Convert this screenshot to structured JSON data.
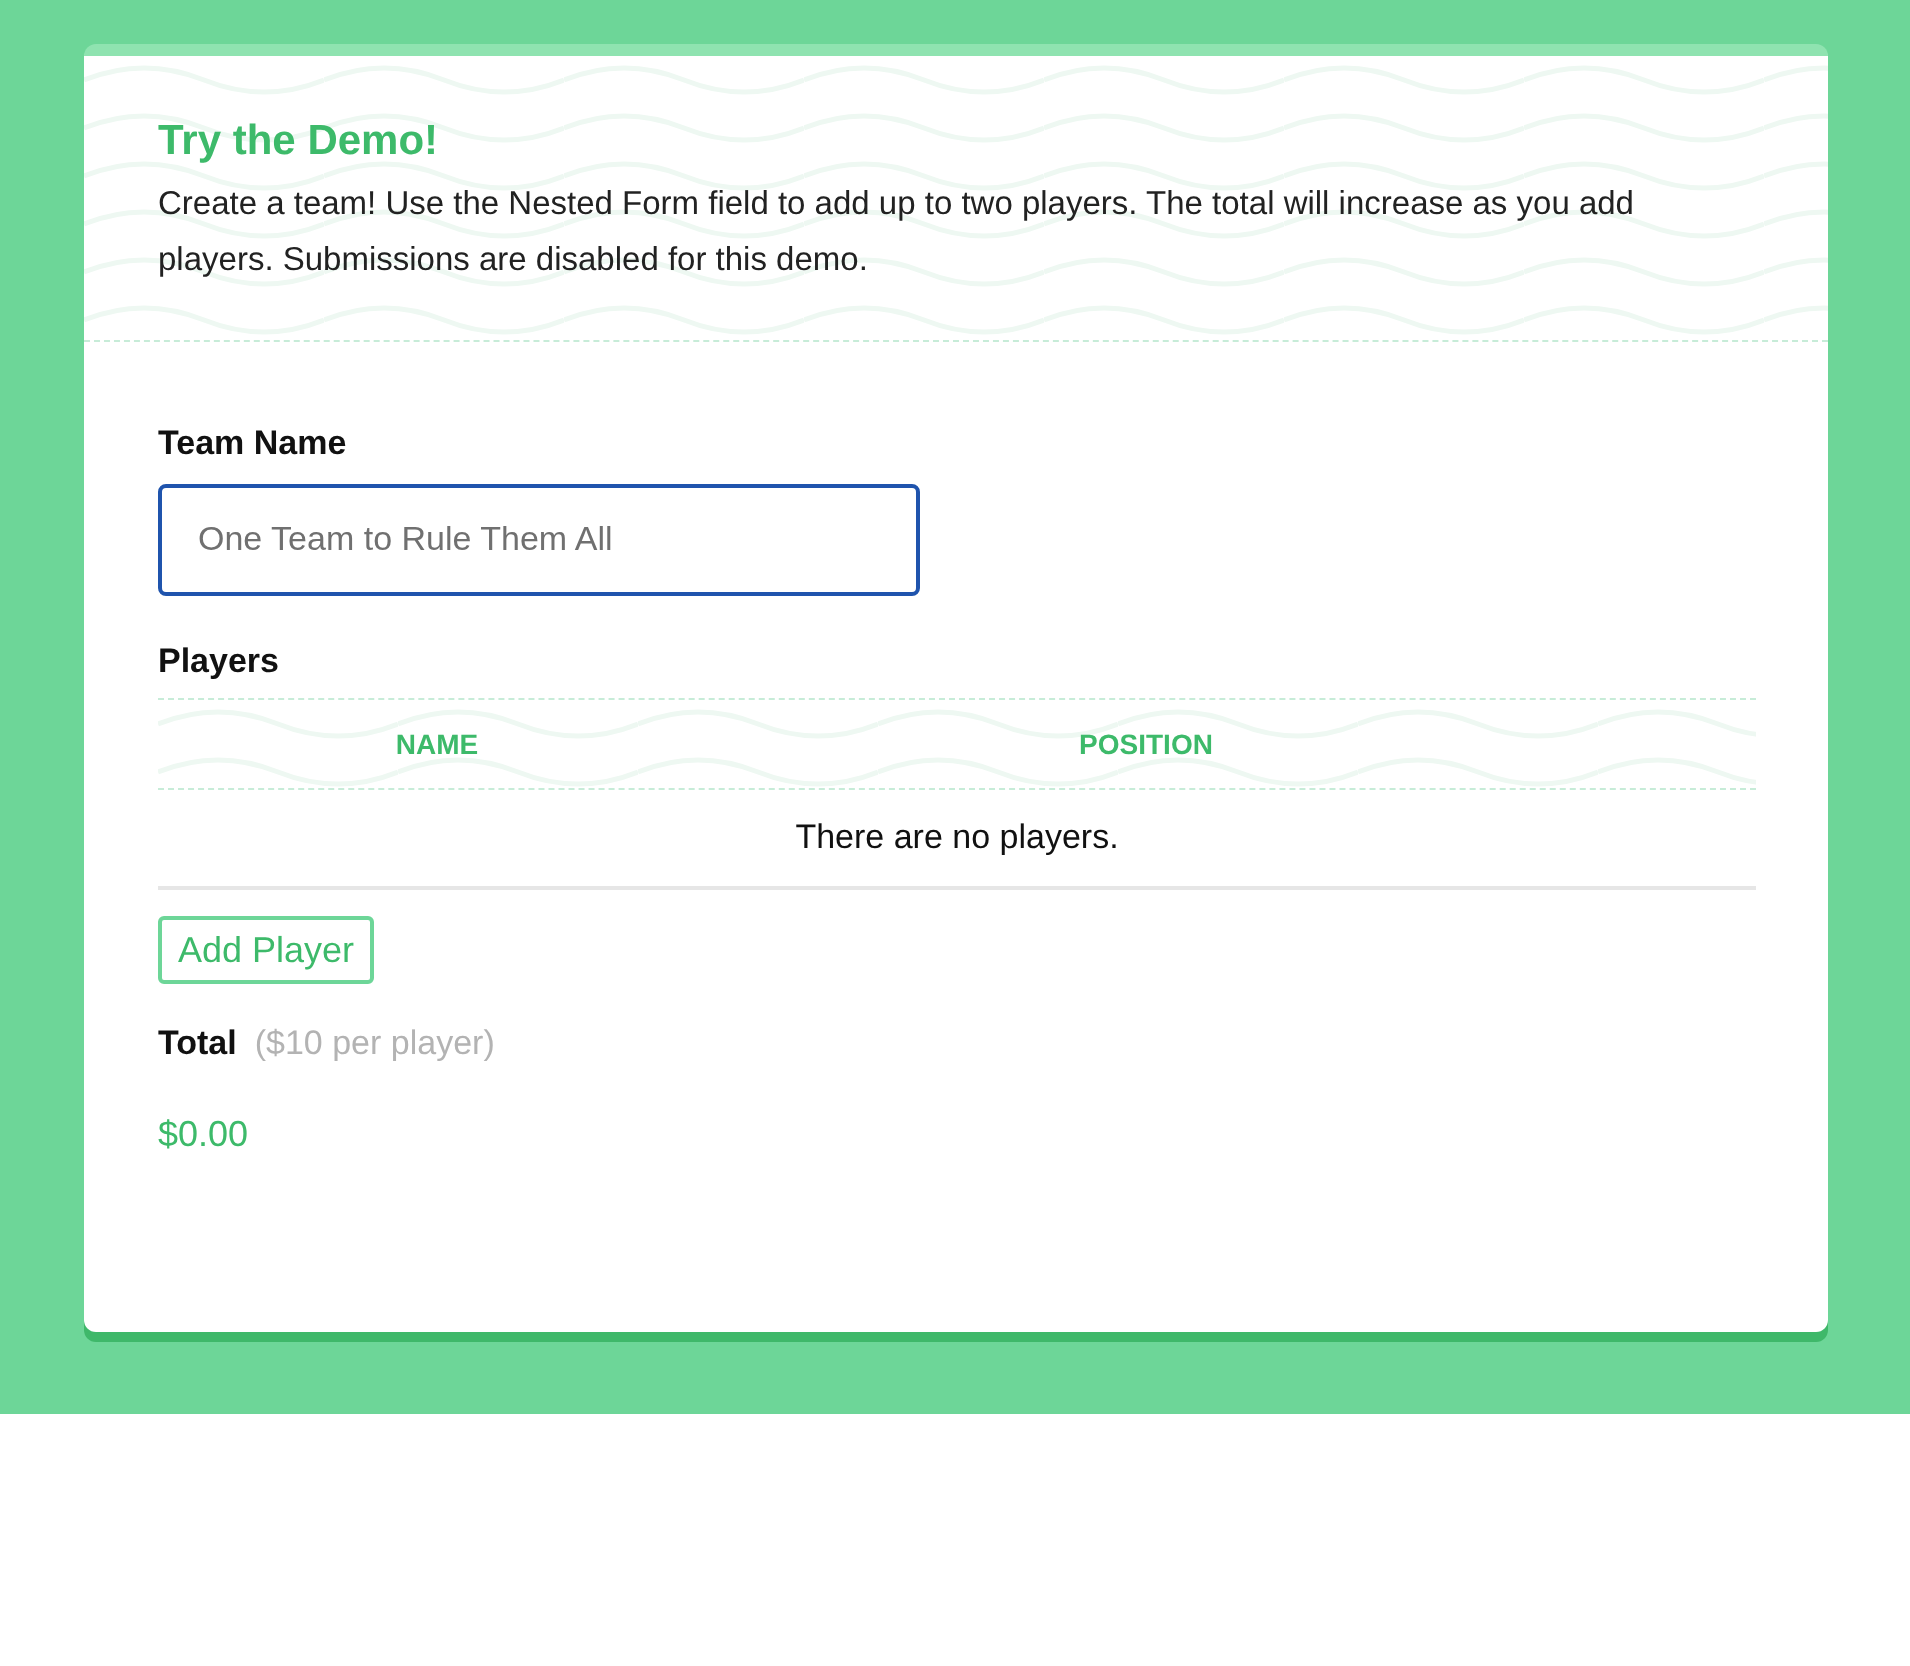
{
  "intro": {
    "title": "Try the Demo!",
    "text": "Create a team! Use the Nested Form field to add up to two players. The total will increase as you add players. Submissions are disabled for this demo."
  },
  "team_name": {
    "label": "Team Name",
    "placeholder": "One Team to Rule Them All",
    "focused": true
  },
  "players": {
    "label": "Players",
    "columns": [
      "NAME",
      "POSITION"
    ],
    "empty_text": "There are no players.",
    "add_button": "Add Player"
  },
  "total": {
    "label": "Total",
    "note": "($10 per player)",
    "amount": "$0.00"
  }
}
